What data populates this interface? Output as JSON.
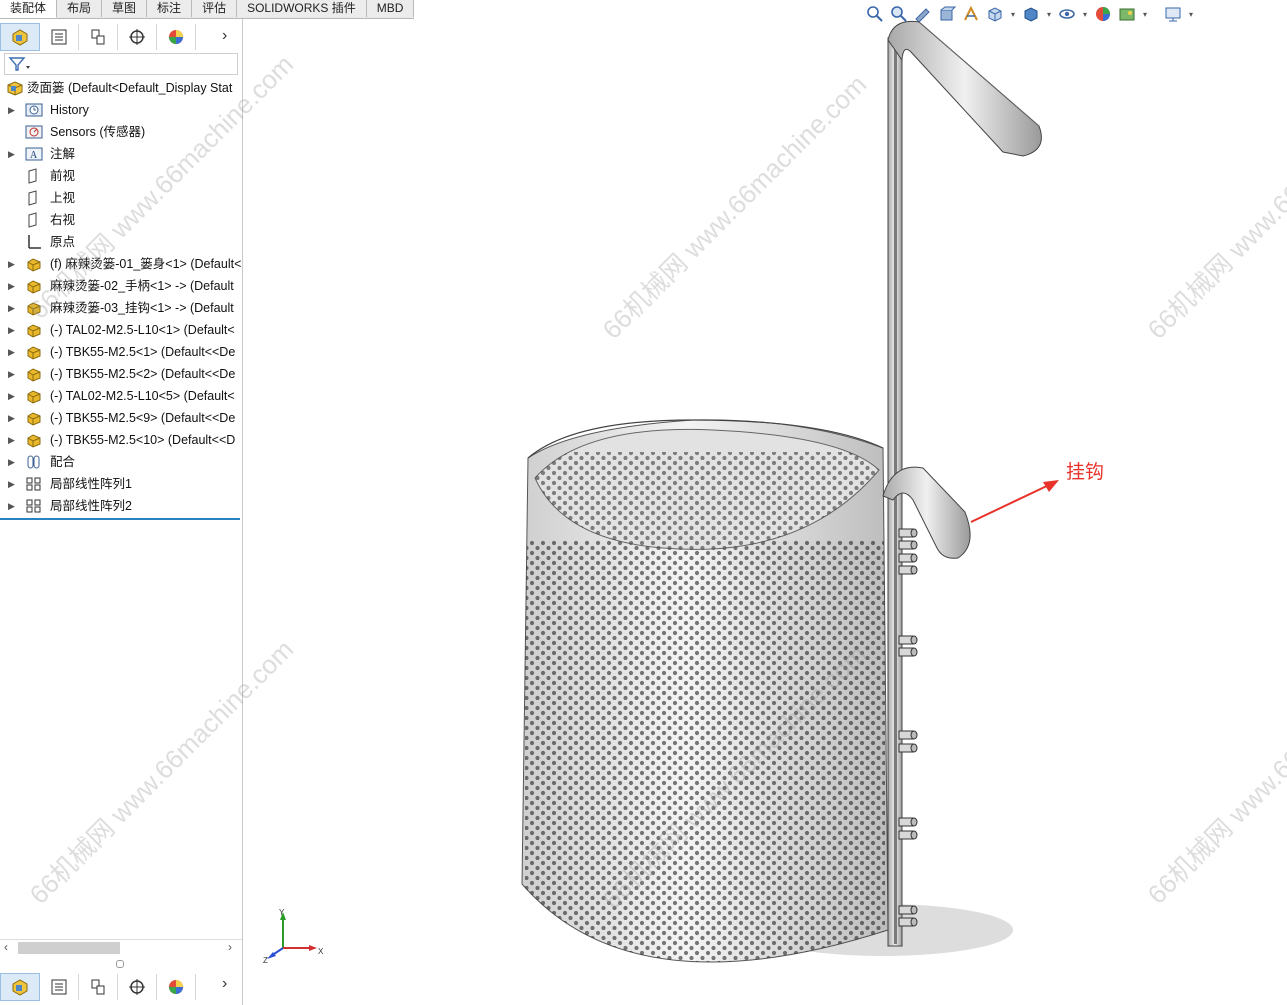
{
  "tabs": [
    "装配体",
    "布局",
    "草图",
    "标注",
    "评估",
    "SOLIDWORKS 插件",
    "MBD"
  ],
  "panel_icons": [
    "featuremanager-icon",
    "propertymanager-icon",
    "configuration-icon",
    "dimxpert-icon",
    "display-manager-icon"
  ],
  "tree": {
    "root": "烫面篓 (Default<Default_Display Stat",
    "items": [
      {
        "label": "History",
        "icon": "history-folder-icon",
        "expand": true
      },
      {
        "label": "Sensors (传感器)",
        "icon": "sensors-icon",
        "expand": false
      },
      {
        "label": "注解",
        "icon": "annotation-icon",
        "expand": true
      },
      {
        "label": "前视",
        "icon": "plane-icon",
        "expand": false
      },
      {
        "label": "上视",
        "icon": "plane-icon",
        "expand": false
      },
      {
        "label": "右视",
        "icon": "plane-icon",
        "expand": false
      },
      {
        "label": "原点",
        "icon": "origin-icon",
        "expand": false
      },
      {
        "label": "(f) 麻辣烫篓-01_篓身<1> (Default<",
        "icon": "part-icon",
        "expand": true
      },
      {
        "label": "麻辣烫篓-02_手柄<1> -> (Default",
        "icon": "part-icon",
        "expand": true
      },
      {
        "label": "麻辣烫篓-03_挂钩<1> -> (Default",
        "icon": "part-icon",
        "expand": true
      },
      {
        "label": "(-) TAL02-M2.5-L10<1> (Default<",
        "icon": "part-icon",
        "expand": true
      },
      {
        "label": "(-) TBK55-M2.5<1> (Default<<De",
        "icon": "part-icon",
        "expand": true
      },
      {
        "label": "(-) TBK55-M2.5<2> (Default<<De",
        "icon": "part-icon",
        "expand": true
      },
      {
        "label": "(-) TAL02-M2.5-L10<5> (Default<",
        "icon": "part-icon",
        "expand": true
      },
      {
        "label": "(-) TBK55-M2.5<9> (Default<<De",
        "icon": "part-icon",
        "expand": true
      },
      {
        "label": "(-) TBK55-M2.5<10> (Default<<D",
        "icon": "part-icon",
        "expand": true
      },
      {
        "label": "配合",
        "icon": "mates-icon",
        "expand": true
      },
      {
        "label": "局部线性阵列1",
        "icon": "pattern-icon",
        "expand": true
      },
      {
        "label": "局部线性阵列2",
        "icon": "pattern-icon",
        "expand": true
      }
    ]
  },
  "callout": "挂钩",
  "triad": {
    "x": "X",
    "y": "Y",
    "z": "Z"
  },
  "watermark": "66机械网 www.66machine.com",
  "colors": {
    "callout": "#e8322a",
    "part_yellow": "#e8b82a",
    "tab_bg": "#e9e9e9"
  }
}
